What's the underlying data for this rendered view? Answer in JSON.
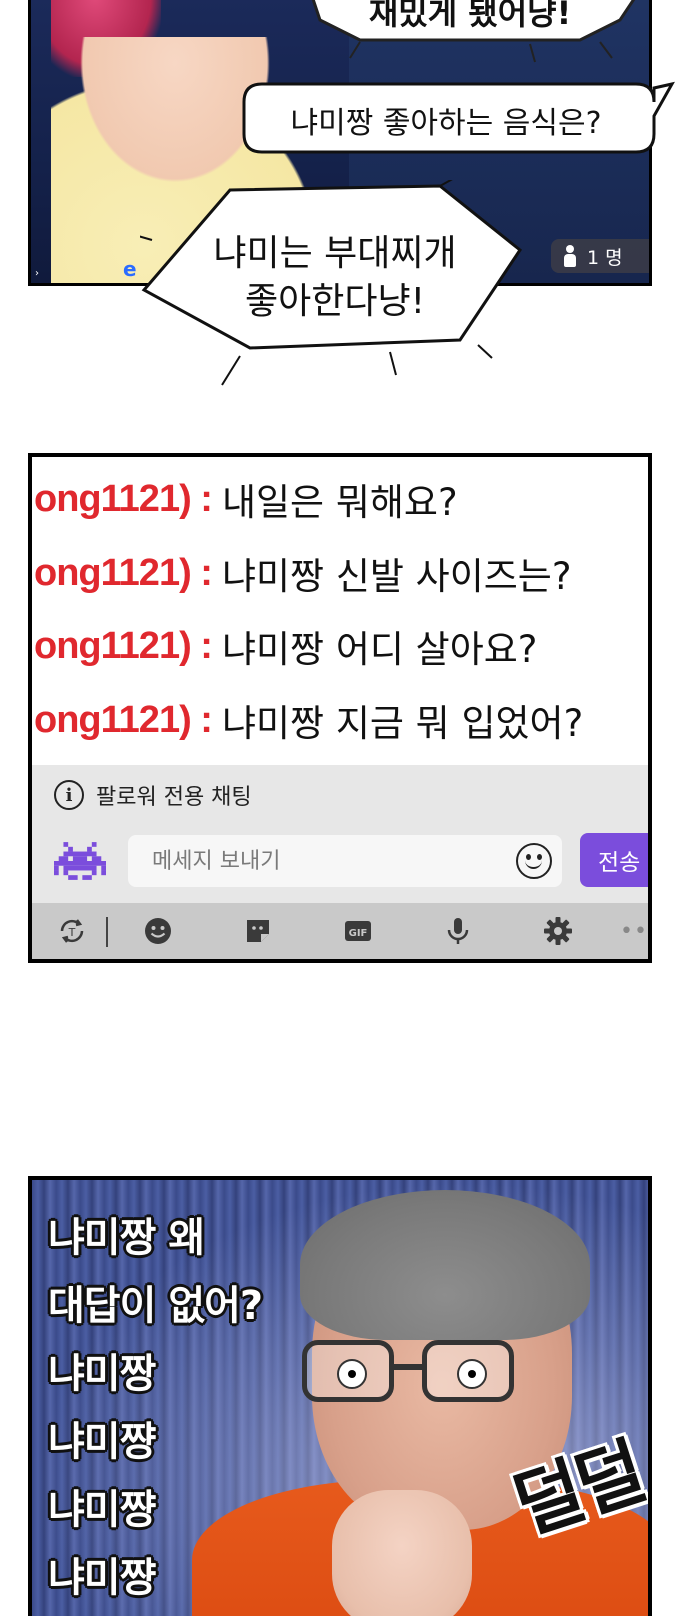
{
  "panel1": {
    "bubble_top": "재밌게 됐어냥!",
    "question_bubble": "냐미짱 좋아하는 음식은?",
    "answer_line1": "냐미는 부대찌개",
    "answer_line2": "좋아한다냥!",
    "viewer_count": "1 명"
  },
  "chat": {
    "username": "ong1121) :",
    "messages": [
      "내일은 뭐해요?",
      "냐미짱 신발 사이즈는?",
      "냐미짱 어디 살아요?",
      "냐미짱 지금 뭐 입었어?"
    ],
    "notice": "팔로워 전용 채팅",
    "input_placeholder": "메세지 보내기",
    "send_label": "전송",
    "gif_label": "GIF",
    "accent_color": "#7b4ddc",
    "username_color": "#e0282e"
  },
  "panel3": {
    "lines": [
      "냐미짱 왜",
      "대답이 없어?",
      "냐미짱",
      "냐미쨩",
      "냐미쨩",
      "냐미쨩"
    ],
    "sfx": "덜덜"
  }
}
